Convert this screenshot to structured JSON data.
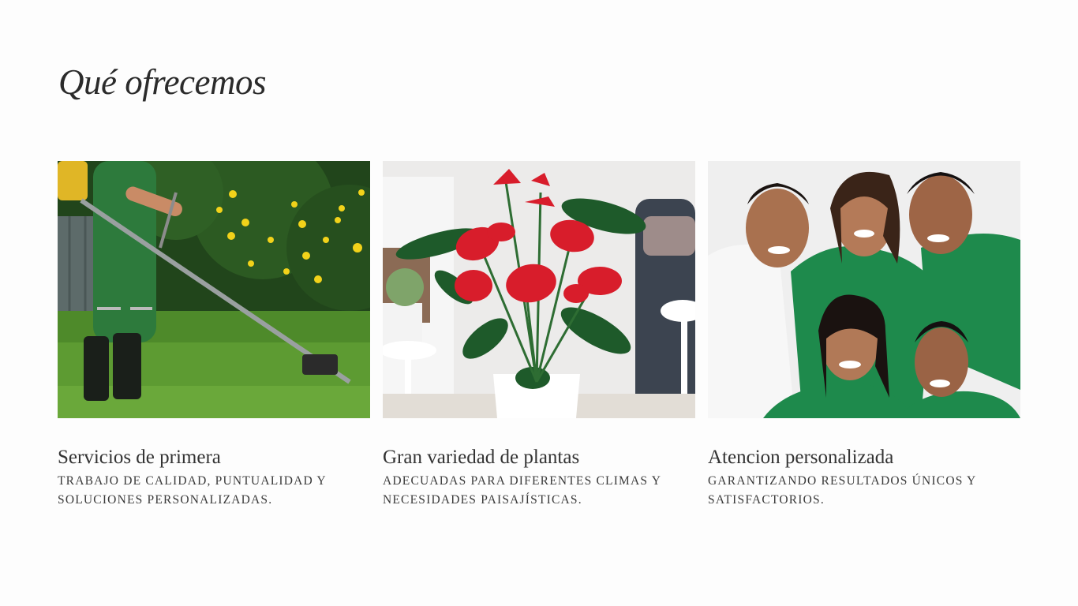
{
  "section": {
    "title": "Qué ofrecemos"
  },
  "cards": [
    {
      "title": "Servicios de primera",
      "description": "Trabajo de calidad, puntualidad y soluciones personalizadas.",
      "image": "gardener-trimming-lawn-photo"
    },
    {
      "title": "Gran variedad de plantas",
      "description": "Adecuadas para diferentes climas y necesidades paisajísticas.",
      "image": "red-anthurium-plant-photo"
    },
    {
      "title": "Atencion personalizada",
      "description": "Garantizando resultados únicos y satisfactorios.",
      "image": "smiling-team-photo"
    }
  ],
  "colors": {
    "background": "#fdfdfd",
    "text": "#2e2e2e",
    "team_green": "#1f8a4c"
  }
}
